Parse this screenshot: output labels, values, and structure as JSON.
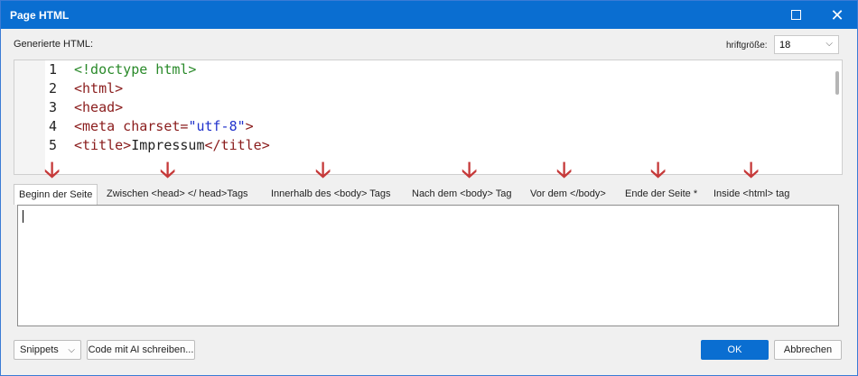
{
  "window": {
    "title": "Page HTML"
  },
  "labels": {
    "generated_html": "Generierte HTML:",
    "font_size": "hriftgröße:"
  },
  "font_size": {
    "value": "18"
  },
  "code_lines": [
    {
      "n": "1",
      "parts": [
        {
          "t": "<!doctype html>",
          "c": "c-doctype"
        }
      ]
    },
    {
      "n": "2",
      "parts": [
        {
          "t": "<html>",
          "c": "c-tag"
        }
      ]
    },
    {
      "n": "3",
      "parts": [
        {
          "t": "<head>",
          "c": "c-tag"
        }
      ]
    },
    {
      "n": "4",
      "parts": [
        {
          "t": "<meta charset=",
          "c": "c-attr"
        },
        {
          "t": "\"utf-8\"",
          "c": "c-str"
        },
        {
          "t": ">",
          "c": "c-attr"
        }
      ]
    },
    {
      "n": "5",
      "parts": [
        {
          "t": "<title>",
          "c": "c-tag"
        },
        {
          "t": "Impressum",
          "c": "c-text"
        },
        {
          "t": "</title>",
          "c": "c-tag"
        }
      ]
    }
  ],
  "tabs": [
    {
      "label": "Beginn der Seite",
      "active": true
    },
    {
      "label": "Zwischen <head> </ head>Tags",
      "active": false
    },
    {
      "label": "Innerhalb des <body> Tags",
      "active": false
    },
    {
      "label": "Nach dem <body> Tag",
      "active": false
    },
    {
      "label": "Vor dem </body>",
      "active": false
    },
    {
      "label": "Ende der Seite *",
      "active": false
    },
    {
      "label": "Inside <html> tag",
      "active": false
    }
  ],
  "buttons": {
    "snippets": "Snippets",
    "ai_code": "Code mit AI schreiben...",
    "ok": "OK",
    "cancel": "Abbrechen"
  },
  "icons": {
    "maximize": "maximize-icon",
    "close": "close-icon",
    "dropdown": "chevron-down-icon",
    "annotation": "red-arrow-icon"
  },
  "colors": {
    "titlebar": "#0a6ed1",
    "annotation": "#c63a3a",
    "ok_button": "#0a6ed1"
  }
}
